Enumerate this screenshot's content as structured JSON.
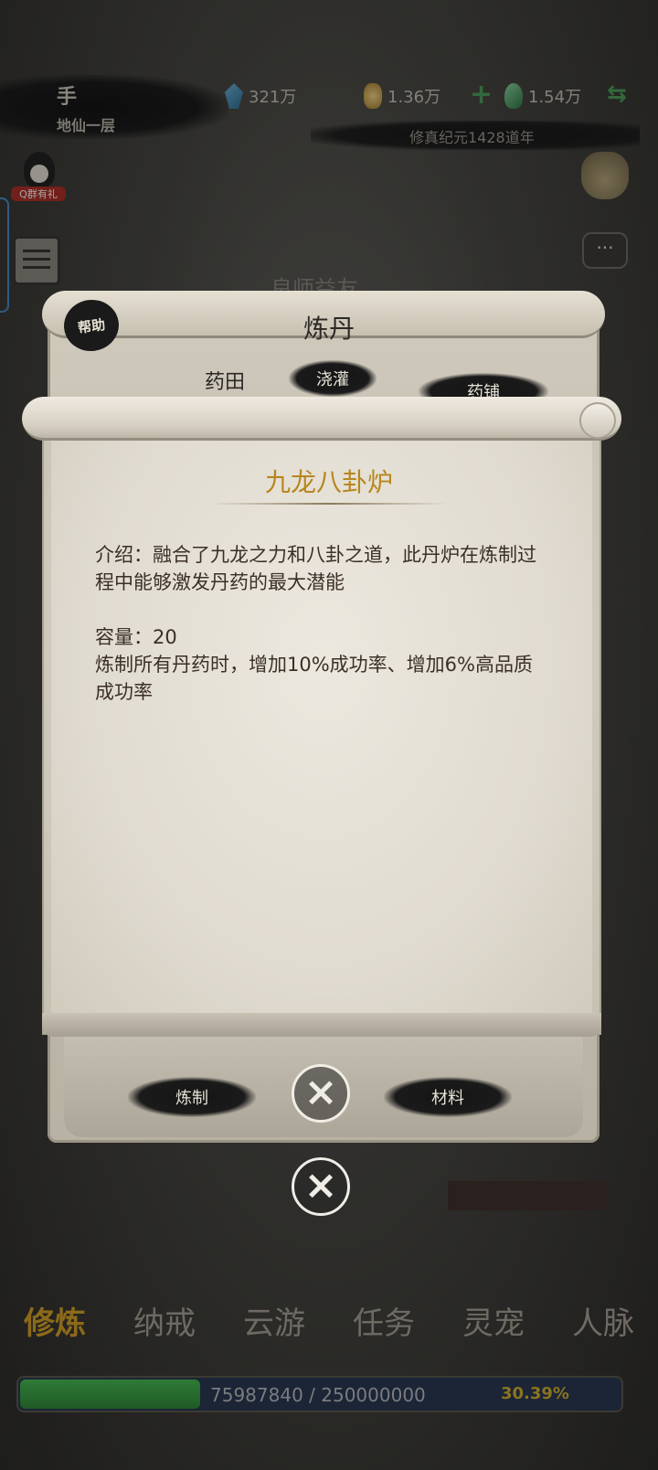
{
  "header": {
    "player_name": "手",
    "player_rank": "地仙一层",
    "resources": [
      {
        "icon": "spirit-stone-icon",
        "value": "321万"
      },
      {
        "icon": "gold-ingot-icon",
        "value": "1.36万"
      },
      {
        "icon": "jade-icon",
        "value": "1.54万"
      }
    ],
    "era": "修真纪元1428道年",
    "qq_label": "Q群有礼"
  },
  "background": {
    "title": "良师益友"
  },
  "alchemy_panel": {
    "title": "炼丹",
    "help_label": "帮助",
    "tab_label": "药田",
    "tab_buttons": [
      "浇灌",
      "药铺"
    ],
    "refine_label": "炼制",
    "material_label": "材料"
  },
  "item_detail": {
    "name": "九龙八卦炉",
    "description": "介绍：融合了九龙之力和八卦之道，此丹炉在炼制过程中能够激发丹药的最大潜能",
    "capacity": "容量：20",
    "effect": "炼制所有丹药时，增加10%成功率、增加6%高品质成功率"
  },
  "bottom_nav": {
    "items": [
      "修炼",
      "纳戒",
      "云游",
      "任务",
      "灵宠",
      "人脉"
    ]
  },
  "xp": {
    "text": "75987840 / 250000000",
    "percent_label": "30.39%",
    "fill_fraction": 0.3039
  },
  "colors": {
    "title_gold": "#b7861e",
    "plus_green": "#4fa05c"
  }
}
